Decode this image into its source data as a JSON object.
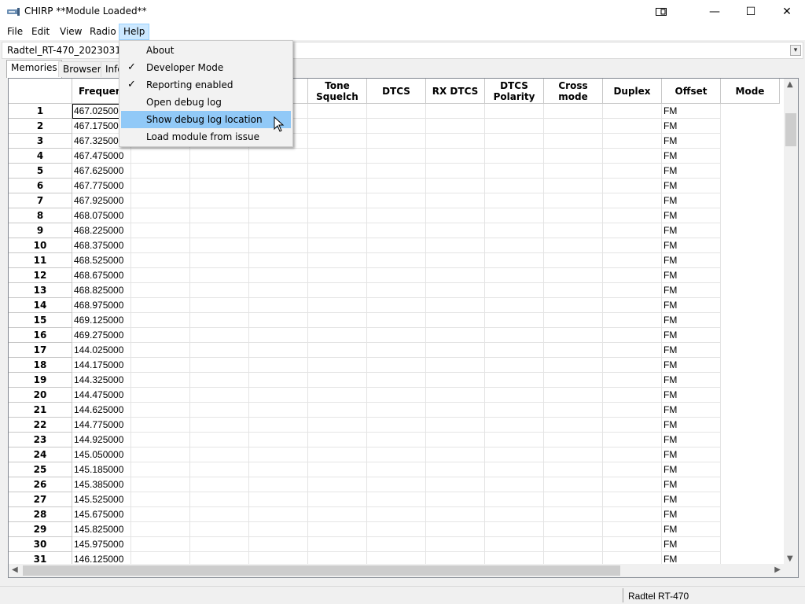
{
  "window": {
    "title": "CHIRP **Module Loaded**",
    "minimize": "—",
    "maximize": "☐",
    "close": "✕"
  },
  "menubar": [
    "File",
    "Edit",
    "View",
    "Radio",
    "Help"
  ],
  "file_tab": "Radtel_RT-470_20230319(fa",
  "notebook_tabs": [
    "Memories",
    "Browser",
    "Info"
  ],
  "columns": [
    "Frequency",
    "",
    "",
    "",
    "Tone\nSquelch",
    "DTCS",
    "RX DTCS",
    "DTCS\nPolarity",
    "Cross mode",
    "Duplex",
    "Offset",
    "Mode"
  ],
  "visible_col_header": "Frequenc",
  "rows": [
    {
      "n": "1",
      "freq": "467.025000",
      "mode": "FM"
    },
    {
      "n": "2",
      "freq": "467.175000",
      "mode": "FM"
    },
    {
      "n": "3",
      "freq": "467.325000",
      "mode": "FM"
    },
    {
      "n": "4",
      "freq": "467.475000",
      "mode": "FM"
    },
    {
      "n": "5",
      "freq": "467.625000",
      "mode": "FM"
    },
    {
      "n": "6",
      "freq": "467.775000",
      "mode": "FM"
    },
    {
      "n": "7",
      "freq": "467.925000",
      "mode": "FM"
    },
    {
      "n": "8",
      "freq": "468.075000",
      "mode": "FM"
    },
    {
      "n": "9",
      "freq": "468.225000",
      "mode": "FM"
    },
    {
      "n": "10",
      "freq": "468.375000",
      "mode": "FM"
    },
    {
      "n": "11",
      "freq": "468.525000",
      "mode": "FM"
    },
    {
      "n": "12",
      "freq": "468.675000",
      "mode": "FM"
    },
    {
      "n": "13",
      "freq": "468.825000",
      "mode": "FM"
    },
    {
      "n": "14",
      "freq": "468.975000",
      "mode": "FM"
    },
    {
      "n": "15",
      "freq": "469.125000",
      "mode": "FM"
    },
    {
      "n": "16",
      "freq": "469.275000",
      "mode": "FM"
    },
    {
      "n": "17",
      "freq": "144.025000",
      "mode": "FM"
    },
    {
      "n": "18",
      "freq": "144.175000",
      "mode": "FM"
    },
    {
      "n": "19",
      "freq": "144.325000",
      "mode": "FM"
    },
    {
      "n": "20",
      "freq": "144.475000",
      "mode": "FM"
    },
    {
      "n": "21",
      "freq": "144.625000",
      "mode": "FM"
    },
    {
      "n": "22",
      "freq": "144.775000",
      "mode": "FM"
    },
    {
      "n": "23",
      "freq": "144.925000",
      "mode": "FM"
    },
    {
      "n": "24",
      "freq": "145.050000",
      "mode": "FM"
    },
    {
      "n": "25",
      "freq": "145.185000",
      "mode": "FM"
    },
    {
      "n": "26",
      "freq": "145.385000",
      "mode": "FM"
    },
    {
      "n": "27",
      "freq": "145.525000",
      "mode": "FM"
    },
    {
      "n": "28",
      "freq": "145.675000",
      "mode": "FM"
    },
    {
      "n": "29",
      "freq": "145.825000",
      "mode": "FM"
    },
    {
      "n": "30",
      "freq": "145.975000",
      "mode": "FM"
    },
    {
      "n": "31",
      "freq": "146.125000",
      "mode": "FM"
    }
  ],
  "status": {
    "radio": "Radtel RT-470"
  },
  "help_menu": {
    "items": [
      {
        "label": "About",
        "checked": false,
        "highlighted": false
      },
      {
        "label": "Developer Mode",
        "checked": true,
        "highlighted": false
      },
      {
        "label": "Reporting enabled",
        "checked": true,
        "highlighted": false
      },
      {
        "label": "Open debug log",
        "checked": false,
        "highlighted": false
      },
      {
        "label": "Show debug log location",
        "checked": false,
        "highlighted": true
      },
      {
        "label": "Load module from issue",
        "checked": false,
        "highlighted": false
      }
    ]
  },
  "colors": {
    "menu_highlight": "#91c9f7",
    "menubar_active": "#cce8ff"
  },
  "icons": {
    "check": "✓",
    "app": "radio-icon",
    "dropdown": "chevron-down-icon"
  }
}
